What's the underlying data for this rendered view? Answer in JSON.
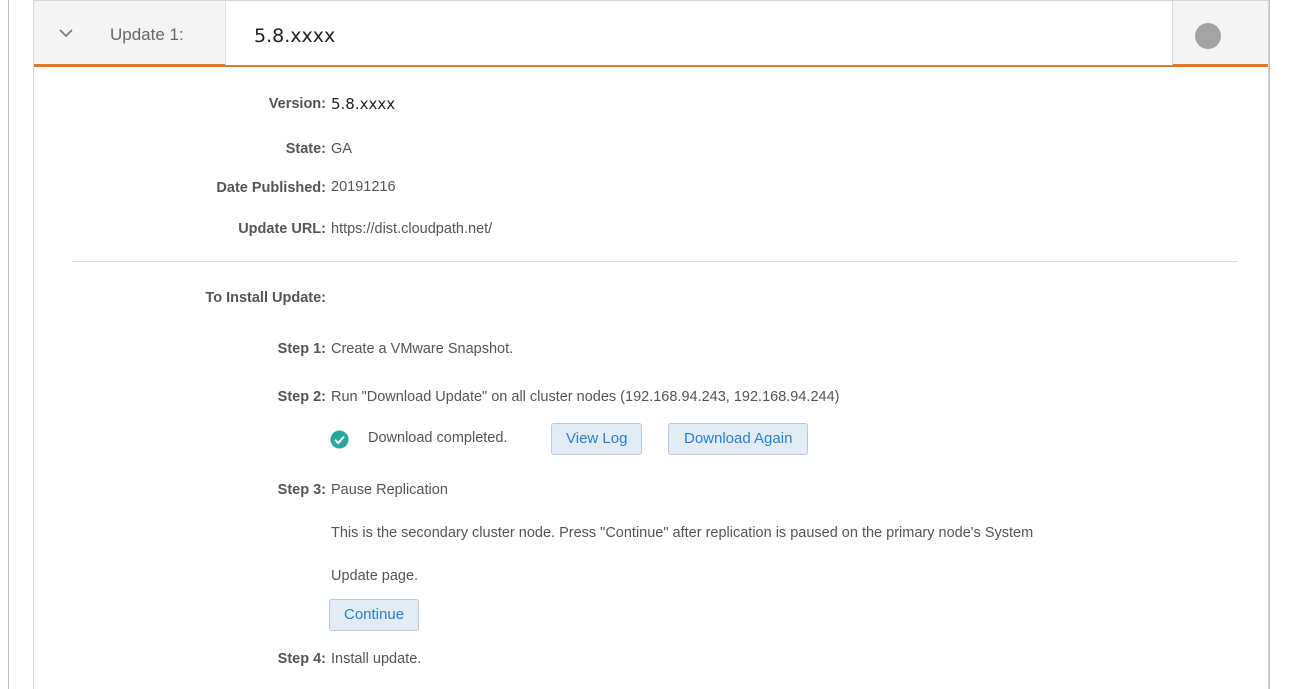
{
  "header": {
    "update_label": "Update 1:",
    "version": "5.8.xxxx",
    "status_color": "#a3a3a3",
    "accent_color": "#e87722"
  },
  "details": {
    "version_label": "Version:",
    "version_value": "5.8.xxxx",
    "state_label": "State:",
    "state_value": "GA",
    "date_label": "Date Published:",
    "date_value": "20191216",
    "url_label": "Update URL:",
    "url_value": "https://dist.cloudpath.net/"
  },
  "install": {
    "heading": "To Install Update:",
    "step1_label": "Step 1:",
    "step1_text": "Create a VMware Snapshot.",
    "step2_label": "Step 2:",
    "step2_text": "Run \"Download Update\" on all cluster nodes (192.168.94.243, 192.168.94.244)",
    "download_status": "Download completed.",
    "view_log_label": "View Log",
    "download_again_label": "Download Again",
    "step3_label": "Step 3:",
    "step3_text": "Pause Replication",
    "step3_desc_line1": "This is the secondary cluster node. Press \"Continue\" after replication is paused on the primary node's System",
    "step3_desc_line2": "Update page.",
    "continue_label": "Continue",
    "step4_label": "Step 4:",
    "step4_text": "Install update."
  }
}
